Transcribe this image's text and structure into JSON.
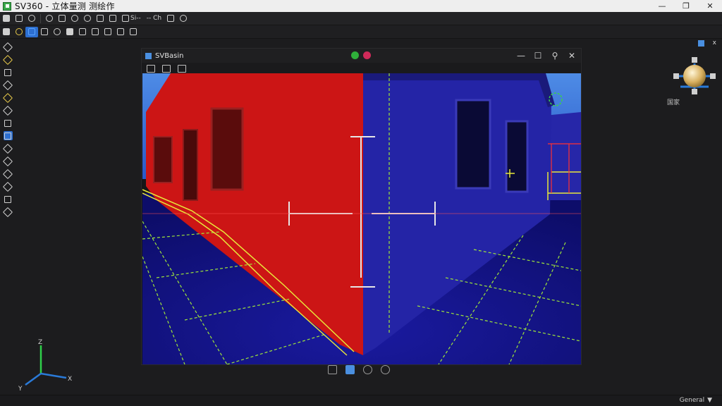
{
  "app": {
    "title": "SV360 - 立体量测 测绘作"
  },
  "window_controls": {
    "minimize": "—",
    "restore": "❐",
    "close": "✕"
  },
  "toolbar1": {
    "buttons": [
      "",
      "",
      "",
      "",
      "",
      "",
      "",
      "",
      ""
    ],
    "text_a": "Si--",
    "text_b": "-- Ch",
    "text_c": ""
  },
  "toolbar2": {
    "buttons": [
      "",
      "",
      "",
      "",
      "",
      "",
      "",
      "",
      "",
      "",
      ""
    ]
  },
  "left_tools": [
    "",
    "",
    "",
    "",
    "",
    "",
    "",
    "",
    "",
    "",
    "",
    "",
    "",
    "",
    ""
  ],
  "document": {
    "title": "SVBasin",
    "controls": {
      "minimize": "—",
      "maximize": "☐",
      "zoom": "⚲",
      "close": "✕"
    }
  },
  "right_panel": {
    "title": "",
    "close": "x",
    "nav_label": "国家"
  },
  "axis_gizmo": {
    "z_label": "Z",
    "y_label": "Y",
    "x_label": "X"
  },
  "status_bar": {
    "dropdown_value": "General"
  },
  "colors": {
    "accent": "#2d6fd0",
    "wall_left": "#d21a1a",
    "wall_right": "#2222b8",
    "grid": "#9ee63a"
  }
}
